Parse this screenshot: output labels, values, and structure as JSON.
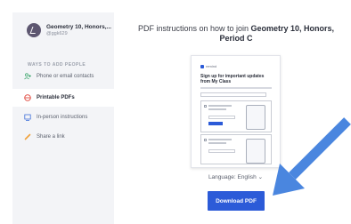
{
  "sidebar": {
    "class_name": "Geometry 10, Honors,...",
    "class_code": "@ggk629",
    "section_label": "WAYS TO ADD PEOPLE",
    "items": [
      {
        "label": "Phone or email contacts",
        "icon": "add-person-icon",
        "color": "#3aa56b"
      },
      {
        "label": "Printable PDFs",
        "icon": "printer-icon",
        "color": "#e0453a"
      },
      {
        "label": "In-person instructions",
        "icon": "presentation-icon",
        "color": "#3f6fd9"
      },
      {
        "label": "Share a link",
        "icon": "link-icon",
        "color": "#f0a23a"
      }
    ],
    "active_index": 1
  },
  "main": {
    "title_prefix": "PDF instructions on how to join ",
    "title_bold": "Geometry 10, Honors, Period C",
    "pdf_preview": {
      "logo_text": "remind",
      "heading": "Sign up for important updates from My Class"
    },
    "language_label": "Language: English",
    "language_chevron": "⌄",
    "download_label": "Download PDF"
  },
  "colors": {
    "accent": "#2c5bd8",
    "arrow": "#4a86df",
    "sidebar_bg": "#f3f4f7"
  }
}
